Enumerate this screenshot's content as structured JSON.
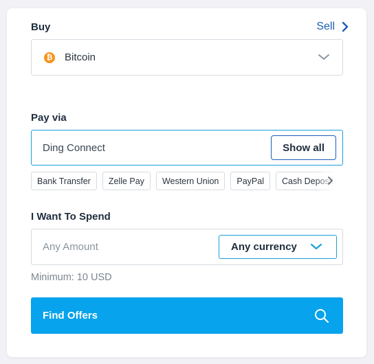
{
  "buy": {
    "label": "Buy",
    "sell_link": "Sell",
    "selected_asset": "Bitcoin",
    "asset_icon_glyph": "₿",
    "asset_icon_color": "#f7931a"
  },
  "pay_via": {
    "label": "Pay via",
    "value": "Ding Connect",
    "show_all_label": "Show all",
    "methods": [
      "Bank Transfer",
      "Zelle Pay",
      "Western Union",
      "PayPal",
      "Cash Deposit"
    ]
  },
  "spend": {
    "label": "I Want To Spend",
    "amount_placeholder": "Any Amount",
    "currency_value": "Any currency",
    "minimum_text": "Minimum: 10 USD"
  },
  "find_offers": {
    "label": "Find Offers"
  },
  "icons": {
    "sell": "chevron-right-icon",
    "asset_select": "chevron-down-icon",
    "chips_scroll": "chevron-right-icon",
    "currency_select": "chevron-down-icon",
    "find_offers": "search-icon"
  },
  "colors": {
    "accent_blue": "#07a3ec",
    "link_blue": "#1a5fb4",
    "focus_border": "#1a9fd8",
    "bitcoin_orange": "#f7931a"
  }
}
